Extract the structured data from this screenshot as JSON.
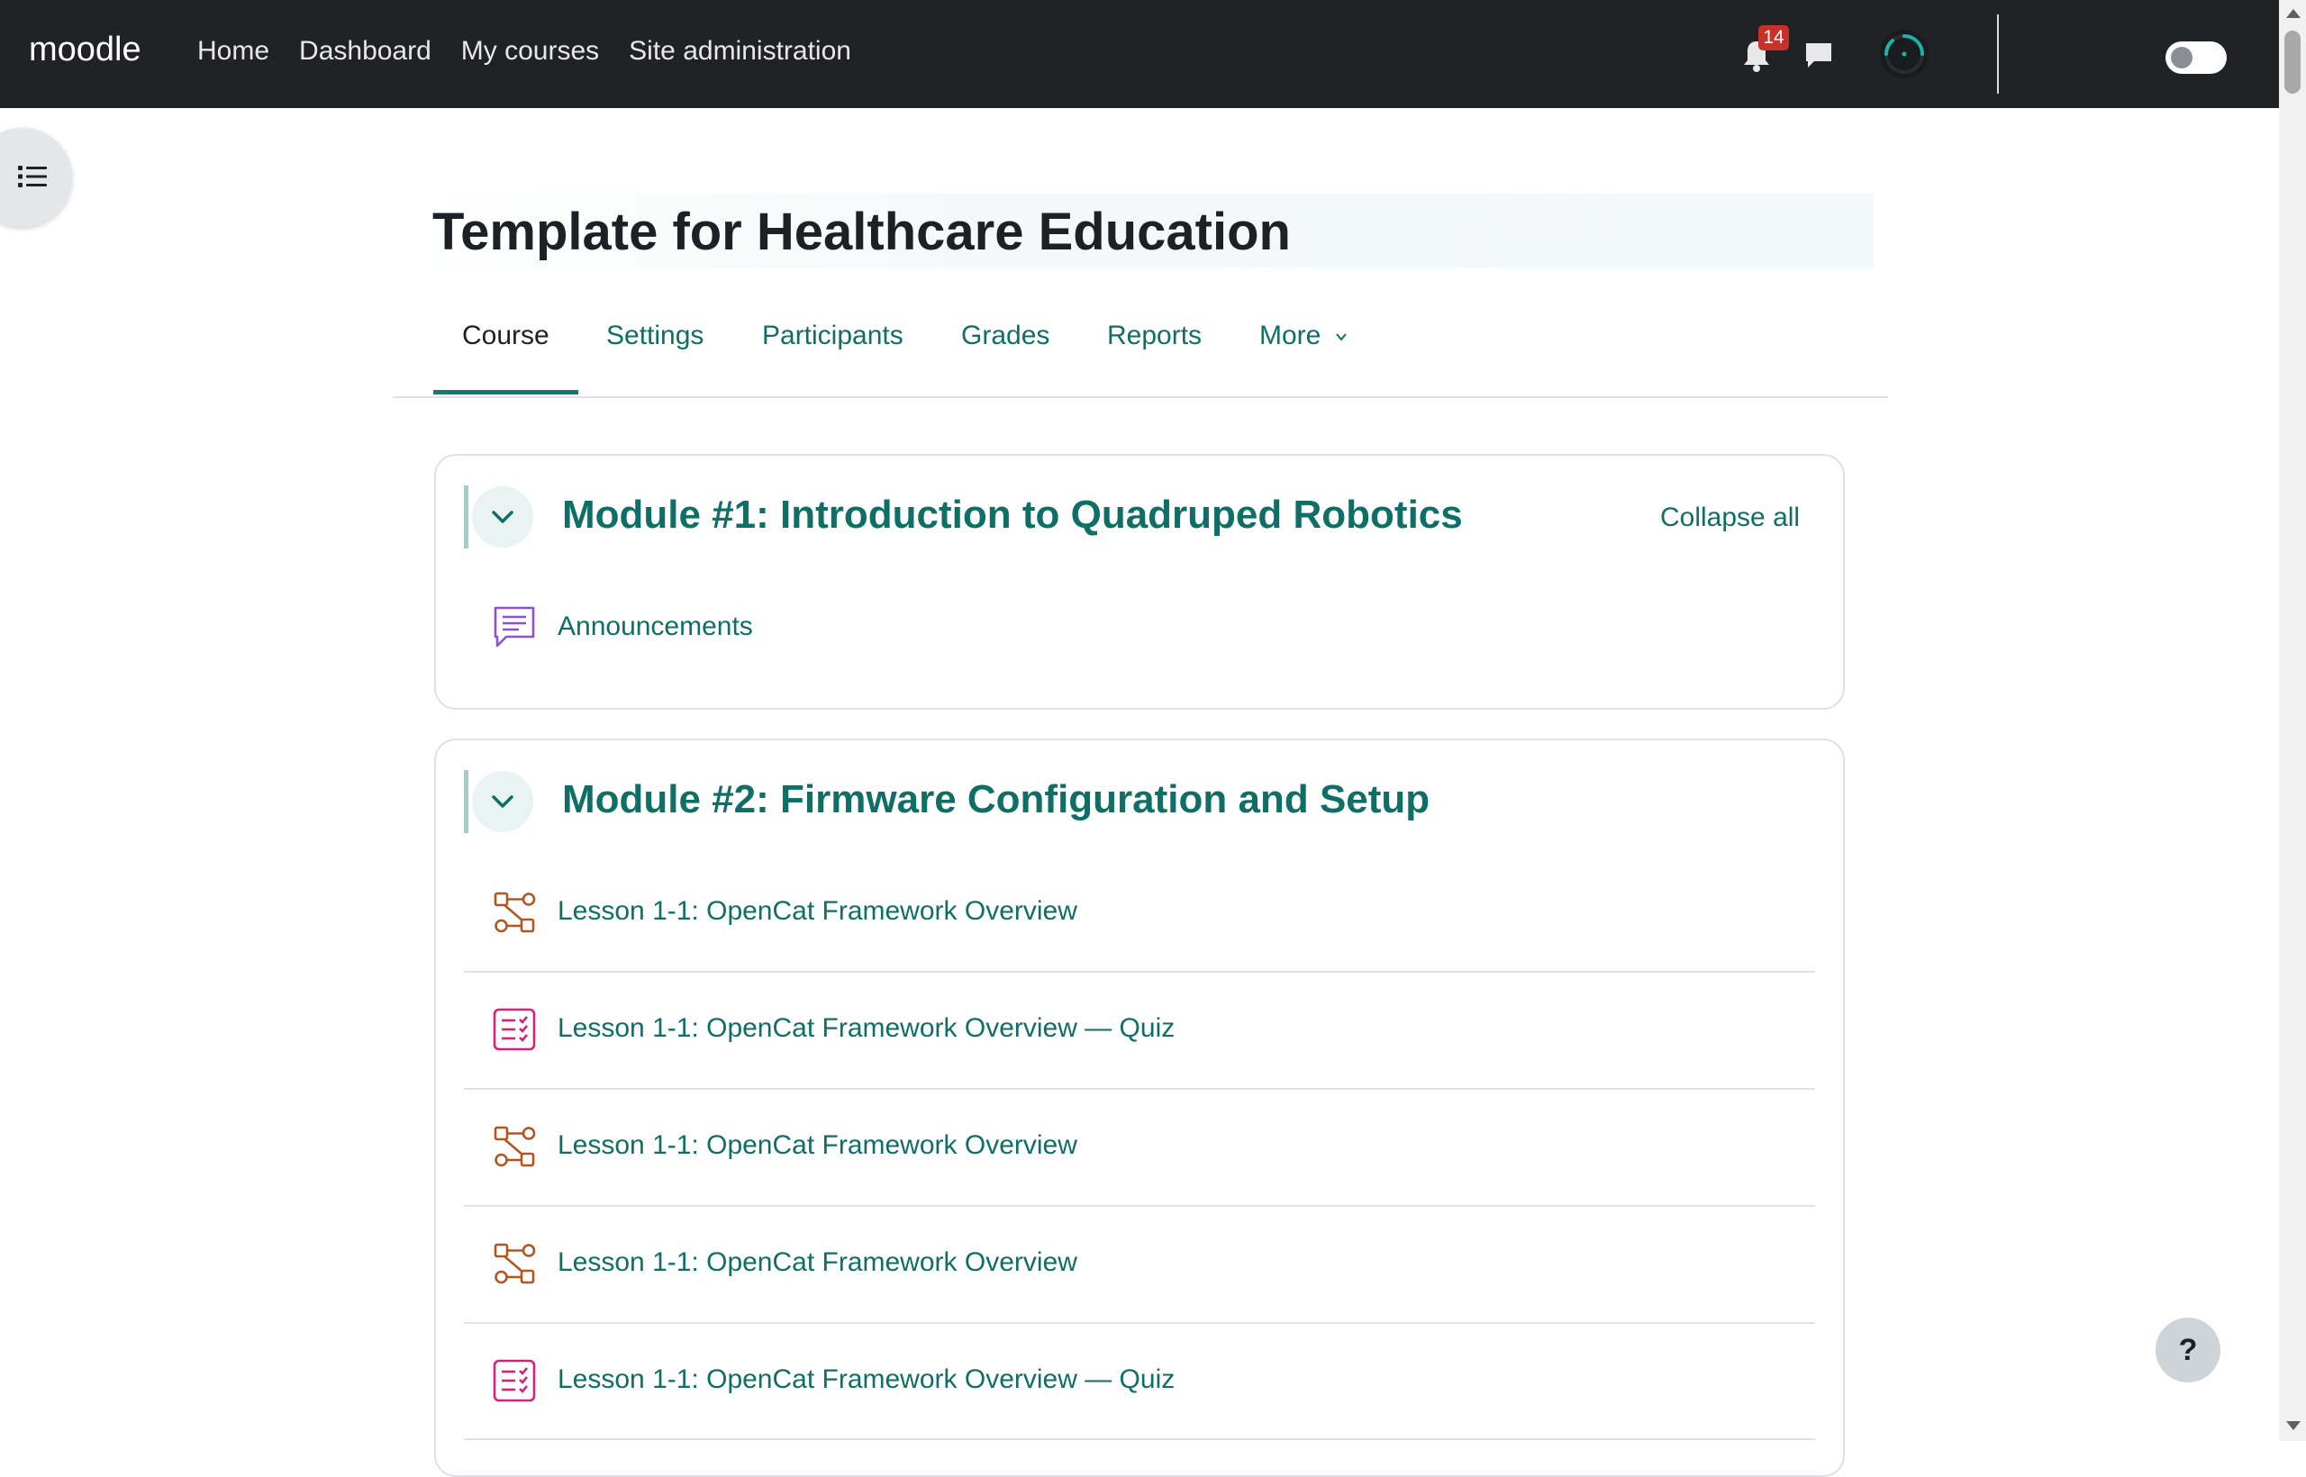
{
  "navbar": {
    "brand": "moodle",
    "links": [
      "Home",
      "Dashboard",
      "My courses",
      "Site administration"
    ],
    "notification_count": "14"
  },
  "course": {
    "title": "Template for Healthcare Education"
  },
  "tabs": [
    "Course",
    "Settings",
    "Participants",
    "Grades",
    "Reports",
    "More"
  ],
  "sections": [
    {
      "title": "Module #1: Introduction to Quadruped Robotics",
      "collapse_all": "Collapse all",
      "activities": [
        {
          "type": "forum",
          "label": "Announcements"
        }
      ]
    },
    {
      "title": "Module #2: Firmware Configuration and Setup",
      "activities": [
        {
          "type": "lesson",
          "label": "Lesson 1-1: OpenCat Framework Overview"
        },
        {
          "type": "quiz",
          "label": "Lesson 1-1: OpenCat Framework Overview — Quiz"
        },
        {
          "type": "lesson",
          "label": "Lesson 1-1: OpenCat Framework Overview"
        },
        {
          "type": "lesson",
          "label": "Lesson 1-1: OpenCat Framework Overview"
        },
        {
          "type": "quiz",
          "label": "Lesson 1-1: OpenCat Framework Overview — Quiz"
        }
      ]
    }
  ],
  "help": "?",
  "colors": {
    "navbar": "#212226",
    "accent": "#0f6e66",
    "forum_icon": "#8f4fd6",
    "lesson_icon": "#b4551f",
    "quiz_icon": "#d6217a",
    "badge": "#c8302a"
  }
}
